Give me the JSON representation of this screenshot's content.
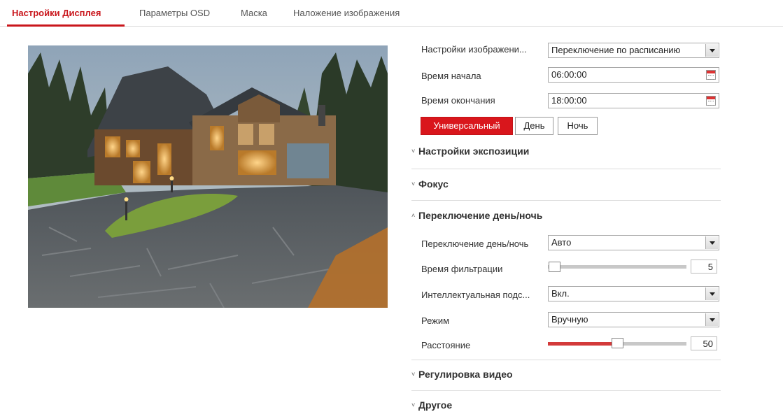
{
  "tabs": [
    {
      "label": "Настройки Дисплея",
      "active": true
    },
    {
      "label": "Параметры OSD",
      "active": false
    },
    {
      "label": "Маска",
      "active": false
    },
    {
      "label": "Наложение изображения",
      "active": false
    }
  ],
  "image_settings": {
    "label": "Настройки изображени...",
    "value": "Переключение по расписанию"
  },
  "start_time": {
    "label": "Время начала",
    "value": "06:00:00"
  },
  "end_time": {
    "label": "Время окончания",
    "value": "18:00:00"
  },
  "modes": [
    "Универсальный",
    "День",
    "Ночь"
  ],
  "sections": {
    "exposure": "Настройки экспозиции",
    "focus": "Фокус",
    "daynight": "Переключение день/ночь",
    "video_adjust": "Регулировка видео",
    "other": "Другое"
  },
  "daynight": {
    "switch_label": "Переключение день/ночь",
    "switch_value": "Авто",
    "filter_label": "Время фильтрации",
    "filter_value": "5",
    "filter_level": 0.0,
    "smart_label": "Интеллектуальная подс...",
    "smart_value": "Вкл.",
    "mode_label": "Режим",
    "mode_value": "Вручную",
    "distance_label": "Расстояние",
    "distance_value": "50",
    "distance_level": 0.5
  },
  "colors": {
    "accent": "#d9161c",
    "tab_active": "#c9161c",
    "slider_fill": "#d33a3a"
  },
  "icons": {
    "calendar": "calendar-icon",
    "dropdown": "chevron-down-icon",
    "collapsed": "chevron-down-icon",
    "expanded": "chevron-up-icon"
  }
}
